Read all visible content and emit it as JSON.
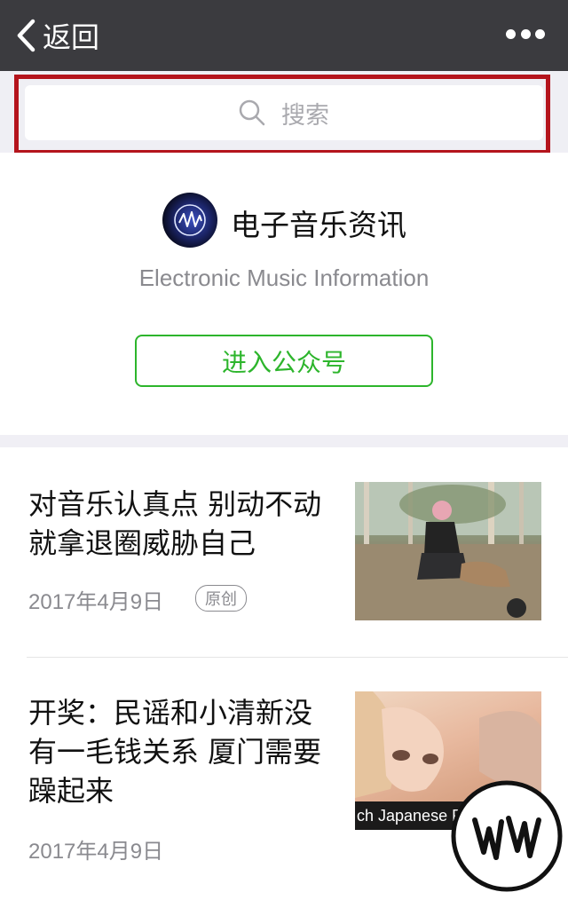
{
  "navbar": {
    "back_label": "返回"
  },
  "search": {
    "placeholder": "搜索"
  },
  "account": {
    "name": "电子音乐资讯",
    "subtitle": "Electronic Music Information",
    "enter_button": "进入公众号"
  },
  "articles": [
    {
      "title": "对音乐认真点 别动不动就拿退圈威胁自己",
      "date": "2017年4月9日",
      "badge": "原创"
    },
    {
      "title": "开奖：民谣和小清新没有一毛钱关系 厦门需要躁起来",
      "date": "2017年4月9日",
      "thumb_caption": "ch Japanese Prostitu"
    }
  ],
  "colors": {
    "navbar_bg": "#3b3b3f",
    "accent_green": "#2db52c",
    "highlight_red": "#b4141c"
  }
}
